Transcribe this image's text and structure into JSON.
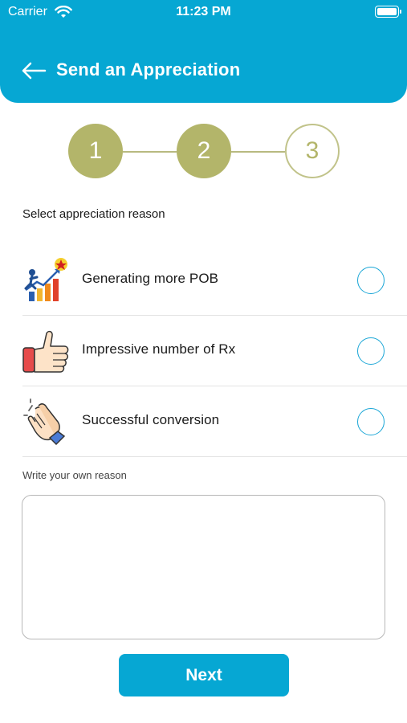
{
  "status_bar": {
    "carrier": "Carrier",
    "time": "11:23 PM",
    "wifi_icon": "wifi-icon",
    "battery_icon": "battery-icon"
  },
  "header": {
    "title": "Send an Appreciation",
    "back_icon": "arrow-left-icon",
    "background": "#06a7d3"
  },
  "stepper": {
    "steps": [
      {
        "label": "1",
        "state": "completed"
      },
      {
        "label": "2",
        "state": "completed"
      },
      {
        "label": "3",
        "state": "pending"
      }
    ],
    "active_color": "#b3b56a"
  },
  "reasons_section": {
    "label": "Select appreciation reason",
    "items": [
      {
        "label": "Generating more POB",
        "icon": "growth-chart-icon",
        "selected": false
      },
      {
        "label": "Impressive number of Rx",
        "icon": "thumbs-up-icon",
        "selected": false
      },
      {
        "label": "Successful conversion",
        "icon": "clapping-hands-icon",
        "selected": false
      }
    ]
  },
  "own_reason": {
    "label": "Write your own reason",
    "value": "",
    "placeholder": ""
  },
  "next_button": {
    "label": "Next",
    "color": "#06a7d3"
  }
}
